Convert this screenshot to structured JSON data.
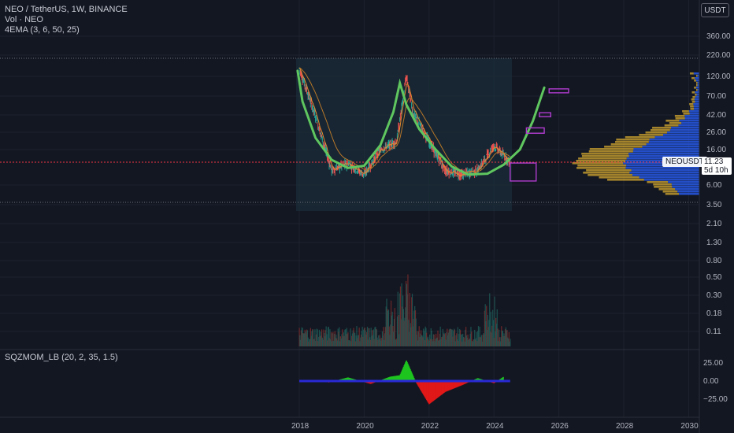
{
  "header": {
    "symbol_line": "NEO / TetherUS, 1W, BINANCE",
    "volume_line": "Vol · NEO",
    "ema_line": "4EMA (3, 6, 50, 25)",
    "currency_button": "USDT"
  },
  "price_marker": {
    "symbol_tag": "NEOUSDT",
    "price": "11.23",
    "countdown": "5d 10h"
  },
  "oscillator": {
    "legend": "SQZMOM_LB (20, 2, 35, 1.5)"
  },
  "colors": {
    "background": "#131722",
    "bull_line": "#26a69a",
    "bear_line": "#ef5350",
    "ema_fast": "#e68a2e",
    "cup_curve": "#5fc65f",
    "profile_up": "#2962ff",
    "profile_down": "#c8a030",
    "box_marker": "#b03ccf",
    "price_line": "#f23645"
  },
  "chart_data": [
    {
      "type": "line",
      "name": "price",
      "yscale": "log",
      "x": [
        "2018",
        "2018.5",
        "2019",
        "2019.5",
        "2020",
        "2020.5",
        "2021",
        "2021.3",
        "2021.5",
        "2022",
        "2022.5",
        "2023",
        "2023.5",
        "2024",
        "2024.5"
      ],
      "values": [
        150,
        40,
        9,
        11,
        8,
        16,
        20,
        120,
        45,
        20,
        9,
        8,
        9,
        18,
        11.23
      ],
      "y_ticks": [
        "360.00",
        "220.00",
        "120.00",
        "70.00",
        "42.00",
        "26.00",
        "16.00",
        "6.00",
        "3.50",
        "2.10",
        "1.30",
        "0.80",
        "0.50",
        "0.30",
        "0.18",
        "0.11"
      ],
      "x_ticks": [
        "2018",
        "2020",
        "2022",
        "2024",
        "2026",
        "2028",
        "2030"
      ]
    },
    {
      "type": "bar",
      "name": "SQZMOM_LB",
      "y_ticks": [
        "25.00",
        "0.00",
        "−25.00"
      ],
      "x": [
        "2018.9",
        "2019.5",
        "2020.2",
        "2020.8",
        "2021.1",
        "2021.3",
        "2021.6",
        "2022",
        "2022.5",
        "2023",
        "2023.5",
        "2024",
        "2024.3"
      ],
      "values": [
        -2,
        5,
        -4,
        6,
        8,
        29,
        -2,
        -32,
        -15,
        -6,
        4,
        -3,
        6
      ]
    }
  ]
}
